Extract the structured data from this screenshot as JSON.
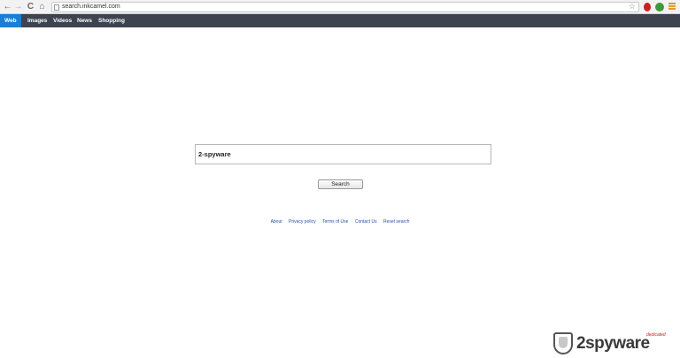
{
  "browser": {
    "url": "search.inkcamel.com",
    "back_icon": "←",
    "forward_icon": "→",
    "reload_icon": "C",
    "home_icon": "⌂",
    "star_icon": "☆"
  },
  "topnav": {
    "tabs": [
      {
        "label": "Web",
        "active": true
      },
      {
        "label": "Images"
      },
      {
        "label": "Videos"
      },
      {
        "label": "News"
      },
      {
        "label": "Shopping"
      }
    ]
  },
  "search": {
    "value": "2-spyware",
    "button_label": "Search"
  },
  "footer": {
    "links": [
      "About",
      "Privacy policy",
      "Terms of Use",
      "Contact Us",
      "Reset search"
    ]
  },
  "watermark": {
    "text": "2spyware",
    "badge": "dedicated",
    "colors": {
      "accent": "#c8231f",
      "dark": "#3a3a3a"
    }
  },
  "colors": {
    "nav_bar": "#3d4450",
    "active_tab": "#1a7fd4",
    "link": "#2a4fa8"
  }
}
